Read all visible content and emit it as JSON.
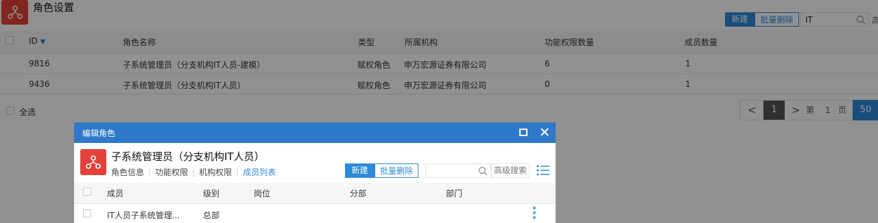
{
  "page": {
    "title": "角色设置",
    "toolbar": {
      "new_label": "新建",
      "batch_delete_label": "批量删除",
      "search_value": "IT",
      "cut_text": "高"
    },
    "table": {
      "headers": {
        "id": "ID",
        "sort_icon": "▼",
        "name": "角色名称",
        "type": "类型",
        "org": "所属机构",
        "func_count": "功能权限数量",
        "member_count": "成员数量"
      },
      "rows": [
        {
          "id": "9816",
          "name": "子系统管理员（分支机构IT人员-建模）",
          "type": "赋权角色",
          "org": "申万宏源证券有限公司",
          "func_count": "6",
          "member_count": "1"
        },
        {
          "id": "9436",
          "name": "子系统管理员（分支机构IT人员）",
          "type": "赋权角色",
          "org": "申万宏源证券有限公司",
          "func_count": "0",
          "member_count": "1"
        }
      ]
    },
    "footer": {
      "select_all": "全选"
    },
    "pager": {
      "prev": "<",
      "current": "1",
      "next": ">",
      "page_label_prefix": "第",
      "page_num": "1",
      "page_label_suffix": "页",
      "page_size": "50"
    }
  },
  "modal": {
    "title": "编辑角色",
    "role_title": "子系统管理员（分支机构IT人员）",
    "tabs": [
      {
        "label": "角色信息",
        "active": false
      },
      {
        "label": "功能权限",
        "active": false
      },
      {
        "label": "机构权限",
        "active": false
      },
      {
        "label": "成员列表",
        "active": true
      }
    ],
    "toolbar": {
      "new_label": "新建",
      "batch_delete_label": "批量删除",
      "search_value": "",
      "advanced_search": "高级搜索"
    },
    "table": {
      "headers": {
        "member": "成员",
        "level": "级别",
        "position": "岗位",
        "branch": "分部",
        "department": "部门"
      },
      "rows": [
        {
          "member": "IT人员子系统管理...",
          "level": "总部",
          "position": "",
          "branch": "",
          "department": ""
        }
      ]
    }
  },
  "colors": {
    "accent": "#2d8ad9",
    "icon_red": "#e5413a",
    "modal_header": "#2d78c8",
    "overlay": "rgba(0,0,0,0.43)"
  },
  "icons": {
    "app": "org-structure-icon",
    "search": "search-icon",
    "close": "close-icon",
    "maximize": "maximize-icon",
    "list": "list-icon",
    "more": "more-vertical-icon"
  }
}
